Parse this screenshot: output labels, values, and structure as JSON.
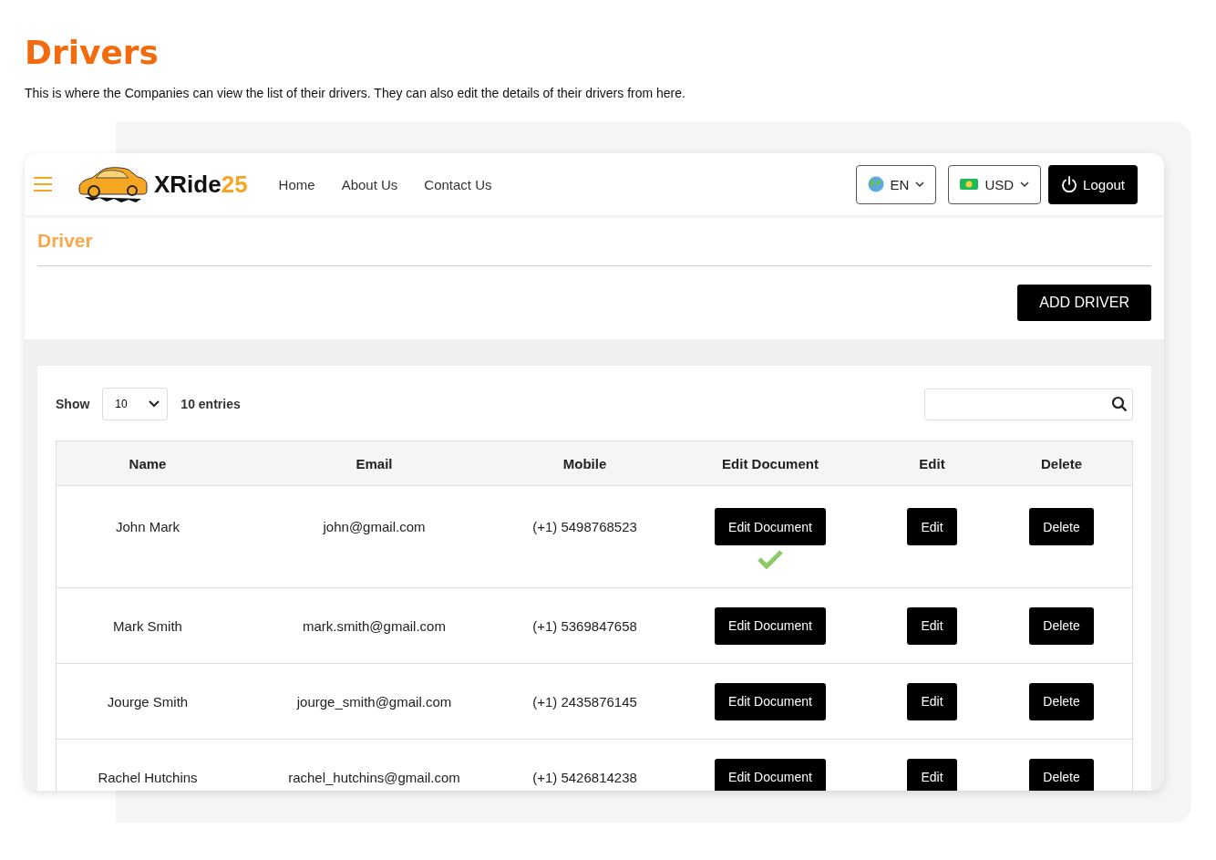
{
  "page": {
    "title": "Drivers",
    "description": "This is where the Companies can view the list of their drivers. They can also edit the details of their drivers from here."
  },
  "navbar": {
    "brand": {
      "name": "XRide",
      "suffix": "25"
    },
    "links": [
      "Home",
      "About Us",
      "Contact Us"
    ],
    "language": "EN",
    "currency": "USD",
    "logout": "Logout"
  },
  "section": {
    "title": "Driver",
    "add_button": "ADD DRIVER"
  },
  "table_controls": {
    "show_label": "Show",
    "page_size": "10",
    "entries_label": "10 entries"
  },
  "table": {
    "columns": [
      "Name",
      "Email",
      "Mobile",
      "Edit Document",
      "Edit",
      "Delete"
    ],
    "rows": [
      {
        "name": "John Mark",
        "email": "john@gmail.com",
        "mobile": "(+1) 5498768523",
        "edit_document": "Edit Document",
        "verified": true,
        "edit": "Edit",
        "delete": "Delete"
      },
      {
        "name": "Mark Smith",
        "email": "mark.smith@gmail.com",
        "mobile": "(+1) 5369847658",
        "edit_document": "Edit Document",
        "verified": false,
        "edit": "Edit",
        "delete": "Delete"
      },
      {
        "name": "Jourge Smith",
        "email": "jourge_smith@gmail.com",
        "mobile": "(+1) 2435876145",
        "edit_document": "Edit Document",
        "verified": false,
        "edit": "Edit",
        "delete": "Delete"
      },
      {
        "name": "Rachel Hutchins",
        "email": "rachel_hutchins@gmail.com",
        "mobile": "(+1) 5426814238",
        "edit_document": "Edit Document",
        "verified": false,
        "edit": "Edit",
        "delete": "Delete"
      }
    ]
  }
}
